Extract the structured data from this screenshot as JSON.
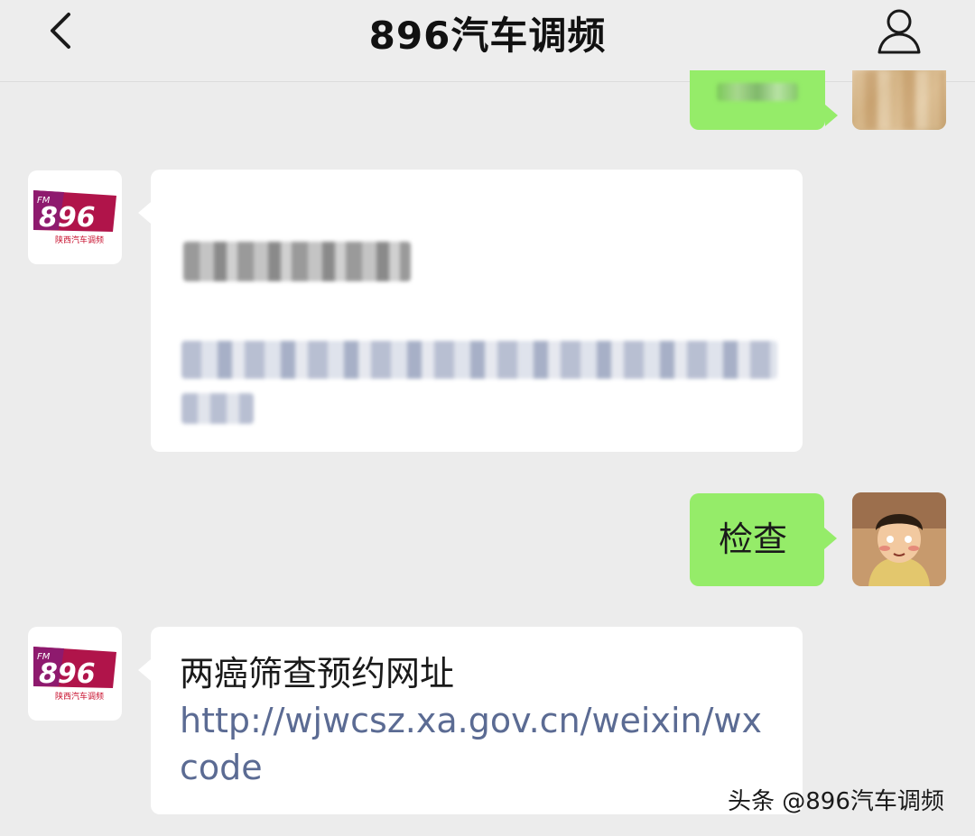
{
  "header": {
    "title": "896汽车调频"
  },
  "messages": {
    "reply_text": "检查",
    "last_title": "两癌筛查预约网址",
    "last_link": "http://wjwcsz.xa.gov.cn/weixin/wxcode"
  },
  "logo": {
    "fm": "FM",
    "number": "896",
    "caption": "陕西汽车调频"
  },
  "watermark": {
    "text": "头条 @896汽车调频"
  },
  "colors": {
    "background": "#ececec",
    "green_bubble": "#95ec69",
    "link": "#5b6b93",
    "logo_red": "#c8102e"
  },
  "icons": {
    "back": "chevron-left-icon",
    "profile": "user-icon"
  }
}
